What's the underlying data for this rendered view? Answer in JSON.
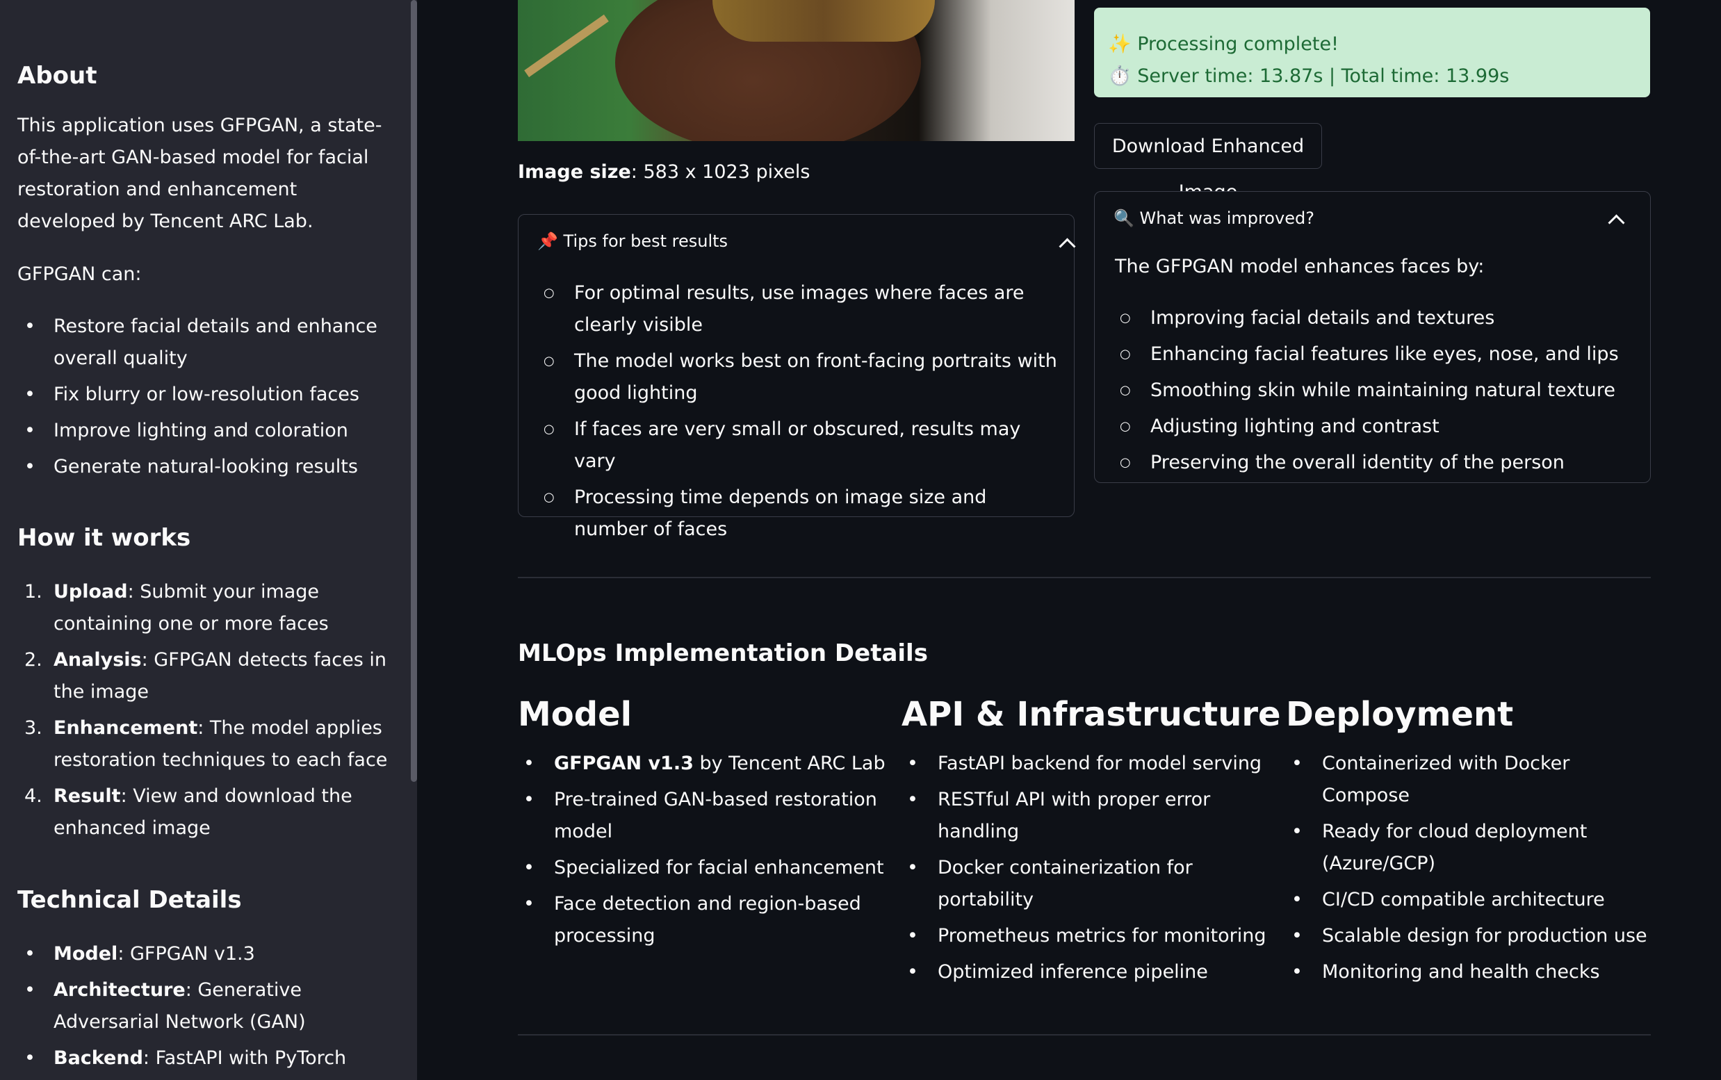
{
  "sidebar": {
    "about_title": "About",
    "about_text": "This application uses GFPGAN, a state-of-the-art GAN-based model for facial restoration and enhancement developed by Tencent ARC Lab.",
    "can_label": "GFPGAN can:",
    "can_items": [
      "Restore facial details and enhance overall quality",
      "Fix blurry or low-resolution faces",
      "Improve lighting and coloration",
      "Generate natural-looking results"
    ],
    "how_title": "How it works",
    "how_items": [
      {
        "num": "1.",
        "bold": "Upload",
        "text": ": Submit your image containing one or more faces"
      },
      {
        "num": "2.",
        "bold": "Analysis",
        "text": ": GFPGAN detects faces in the image"
      },
      {
        "num": "3.",
        "bold": "Enhancement",
        "text": ": The model applies restoration techniques to each face"
      },
      {
        "num": "4.",
        "bold": "Result",
        "text": ": View and download the enhanced image"
      }
    ],
    "tech_title": "Technical Details",
    "tech_items": [
      {
        "bold": "Model",
        "text": ": GFPGAN v1.3"
      },
      {
        "bold": "Architecture",
        "text": ": Generative Adversarial Network (GAN)"
      },
      {
        "bold": "Backend",
        "text": ": FastAPI with PyTorch"
      }
    ]
  },
  "image_caption": {
    "bold": "Image size",
    "text": ": 583 x 1023 pixels"
  },
  "tips": {
    "icon": "📌",
    "title": "Tips for best results",
    "items": [
      "For optimal results, use images where faces are clearly visible",
      "The model works best on front-facing portraits with good lighting",
      "If faces are very small or obscured, results may vary",
      "Processing time depends on image size and number of faces"
    ]
  },
  "status": {
    "line1_icon": "✨",
    "line1": "Processing complete!",
    "line2_icon": "⏱️",
    "line2": "Server time: 13.87s | Total time: 13.99s"
  },
  "download_label": "Download Enhanced Image",
  "improved": {
    "icon": "🔍",
    "title": "What was improved?",
    "intro": "The GFPGAN model enhances faces by:",
    "items": [
      "Improving facial details and textures",
      "Enhancing facial features like eyes, nose, and lips",
      "Smoothing skin while maintaining natural texture",
      "Adjusting lighting and contrast",
      "Preserving the overall identity of the person"
    ]
  },
  "mlops": {
    "title": "MLOps Implementation Details",
    "model": {
      "title": "Model",
      "items": [
        {
          "bold": "GFPGAN v1.3",
          "text": " by Tencent ARC Lab"
        },
        {
          "bold": "",
          "text": "Pre-trained GAN-based restoration model"
        },
        {
          "bold": "",
          "text": "Specialized for facial enhancement"
        },
        {
          "bold": "",
          "text": "Face detection and region-based processing"
        }
      ]
    },
    "api": {
      "title": "API & Infrastructure",
      "items": [
        "FastAPI backend for model serving",
        "RESTful API with proper error handling",
        "Docker containerization for portability",
        "Prometheus metrics for monitoring",
        "Optimized inference pipeline"
      ]
    },
    "deploy": {
      "title": "Deployment",
      "items": [
        "Containerized with Docker Compose",
        "Ready for cloud deployment (Azure/GCP)",
        "CI/CD compatible architecture",
        "Scalable design for production use",
        "Monitoring and health checks"
      ]
    }
  }
}
